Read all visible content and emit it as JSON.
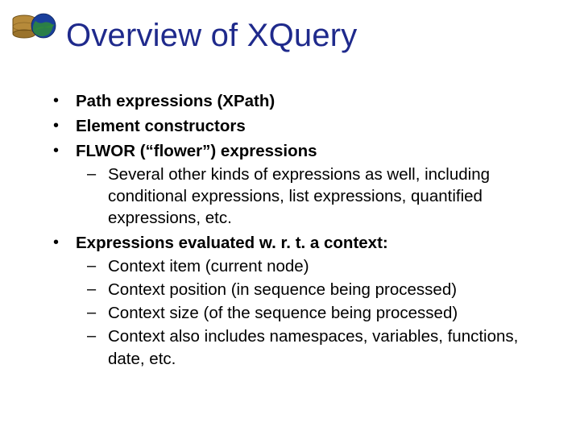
{
  "title": "Overview of XQuery",
  "bullets": {
    "b1": "Path expressions (XPath)",
    "b2": "Element constructors",
    "b3": "FLWOR (“flower”) expressions",
    "b3_sub1": "Several other kinds of expressions as well, including conditional expressions, list expressions, quantified expressions, etc.",
    "b4": "Expressions evaluated w. r. t. a context:",
    "b4_sub1": "Context item (current node)",
    "b4_sub2": "Context position (in sequence being processed)",
    "b4_sub3": "Context size (of the sequence being processed)",
    "b4_sub4": "Context also includes namespaces, variables, functions, date, etc."
  }
}
